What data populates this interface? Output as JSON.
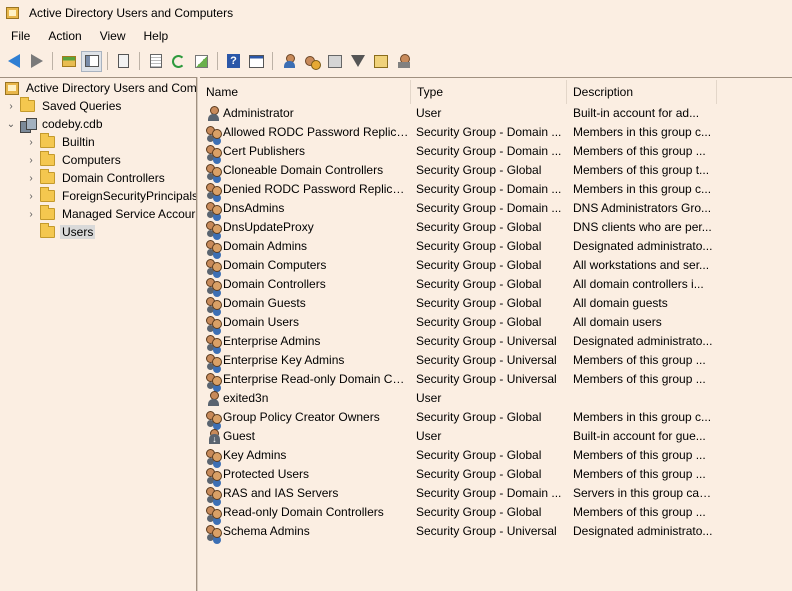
{
  "window": {
    "title": "Active Directory Users and Computers"
  },
  "menu": [
    "File",
    "Action",
    "View",
    "Help"
  ],
  "toolbar": {
    "icons": [
      "back-arrow-icon",
      "forward-arrow-icon",
      "up-folder-icon",
      "show-hide-tree-icon",
      "clipboard-icon",
      "export-list-doc-icon",
      "refresh-icon",
      "export-icon",
      "help-icon",
      "properties-icon",
      "new-user-icon",
      "new-group-icon",
      "new-ou-icon",
      "filter-icon",
      "find-icon",
      "delegate-control-icon"
    ]
  },
  "tree": {
    "root": "Active Directory Users and Com",
    "saved_queries": "Saved Queries",
    "domain": "codeby.cdb",
    "containers": [
      "Builtin",
      "Computers",
      "Domain Controllers",
      "ForeignSecurityPrincipals",
      "Managed Service Accour",
      "Users"
    ],
    "selected": "Users"
  },
  "list": {
    "columns": [
      "Name",
      "Type",
      "Description"
    ],
    "rows": [
      {
        "icon": "user",
        "name": "Administrator",
        "type": "User",
        "description": "Built-in account for ad..."
      },
      {
        "icon": "group",
        "name": "Allowed RODC Password Replicat...",
        "type": "Security Group - Domain ...",
        "description": "Members in this group c..."
      },
      {
        "icon": "group",
        "name": "Cert Publishers",
        "type": "Security Group - Domain ...",
        "description": "Members of this group ..."
      },
      {
        "icon": "group",
        "name": "Cloneable Domain Controllers",
        "type": "Security Group - Global",
        "description": "Members of this group t..."
      },
      {
        "icon": "group",
        "name": "Denied RODC Password Replicati...",
        "type": "Security Group - Domain ...",
        "description": "Members in this group c..."
      },
      {
        "icon": "group",
        "name": "DnsAdmins",
        "type": "Security Group - Domain ...",
        "description": "DNS Administrators Gro..."
      },
      {
        "icon": "group",
        "name": "DnsUpdateProxy",
        "type": "Security Group - Global",
        "description": "DNS clients who are per..."
      },
      {
        "icon": "group",
        "name": "Domain Admins",
        "type": "Security Group - Global",
        "description": "Designated administrato..."
      },
      {
        "icon": "group",
        "name": "Domain Computers",
        "type": "Security Group - Global",
        "description": "All workstations and ser..."
      },
      {
        "icon": "group",
        "name": "Domain Controllers",
        "type": "Security Group - Global",
        "description": "All domain controllers i..."
      },
      {
        "icon": "group",
        "name": "Domain Guests",
        "type": "Security Group - Global",
        "description": "All domain guests"
      },
      {
        "icon": "group",
        "name": "Domain Users",
        "type": "Security Group - Global",
        "description": "All domain users"
      },
      {
        "icon": "group",
        "name": "Enterprise Admins",
        "type": "Security Group - Universal",
        "description": "Designated administrato..."
      },
      {
        "icon": "group",
        "name": "Enterprise Key Admins",
        "type": "Security Group - Universal",
        "description": "Members of this group ..."
      },
      {
        "icon": "group",
        "name": "Enterprise Read-only Domain Co...",
        "type": "Security Group - Universal",
        "description": "Members of this group ..."
      },
      {
        "icon": "user",
        "name": "exited3n",
        "type": "User",
        "description": ""
      },
      {
        "icon": "group",
        "name": "Group Policy Creator Owners",
        "type": "Security Group - Global",
        "description": "Members in this group c..."
      },
      {
        "icon": "disabled-user",
        "name": "Guest",
        "type": "User",
        "description": "Built-in account for gue..."
      },
      {
        "icon": "group",
        "name": "Key Admins",
        "type": "Security Group - Global",
        "description": "Members of this group ..."
      },
      {
        "icon": "group",
        "name": "Protected Users",
        "type": "Security Group - Global",
        "description": "Members of this group ..."
      },
      {
        "icon": "group",
        "name": "RAS and IAS Servers",
        "type": "Security Group - Domain ...",
        "description": "Servers in this group can..."
      },
      {
        "icon": "group",
        "name": "Read-only Domain Controllers",
        "type": "Security Group - Global",
        "description": "Members of this group ..."
      },
      {
        "icon": "group",
        "name": "Schema Admins",
        "type": "Security Group - Universal",
        "description": "Designated administrato..."
      }
    ]
  }
}
